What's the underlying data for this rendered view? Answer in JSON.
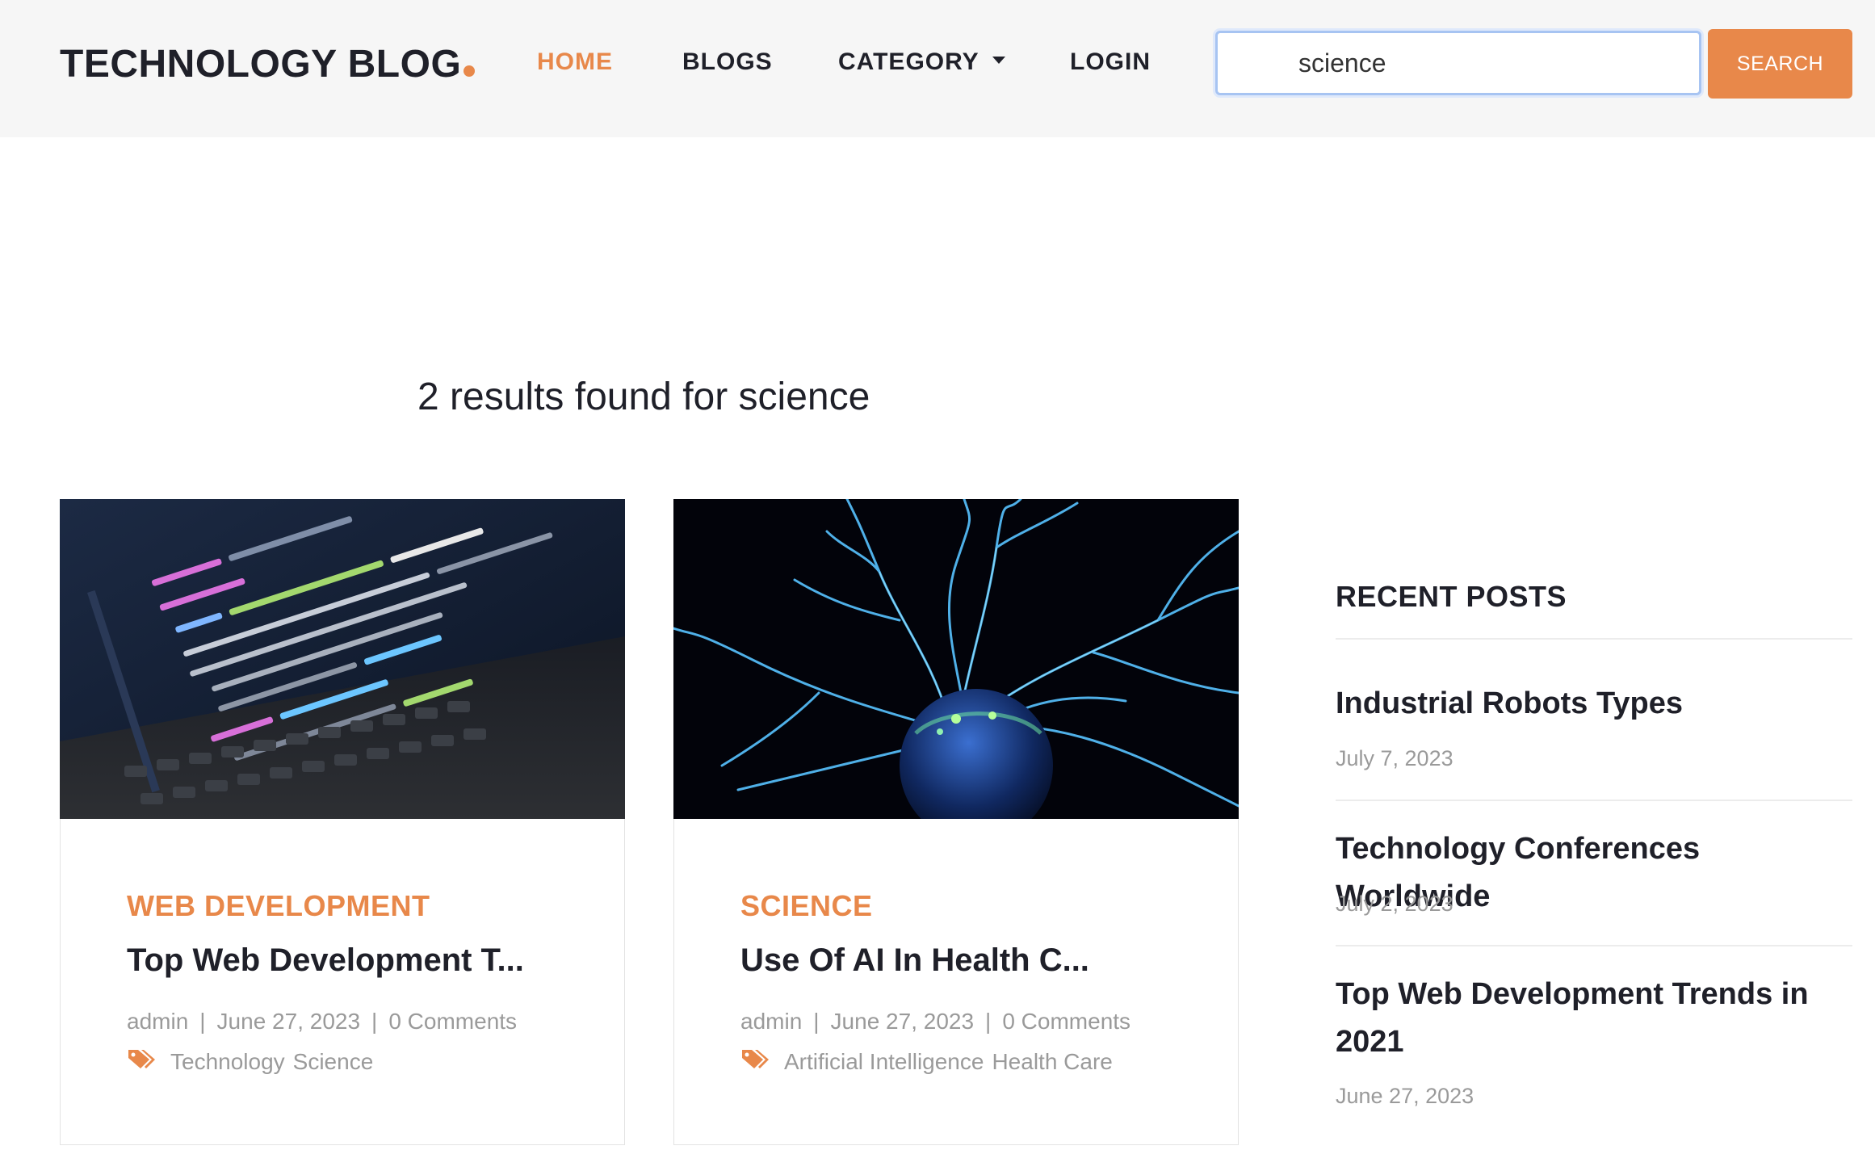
{
  "header": {
    "logo": "TECHNOLOGY BLOG",
    "nav": {
      "home": "HOME",
      "blogs": "BLOGS",
      "category": "CATEGORY",
      "login": "LOGIN"
    },
    "search": {
      "value": "science",
      "button": "SEARCH"
    }
  },
  "results": {
    "heading": "2 results found for science"
  },
  "cards": [
    {
      "category": "WEB DEVELOPMENT",
      "title": "Top Web Development T...",
      "author": "admin",
      "date": "June 27, 2023",
      "comments": "0 Comments",
      "tags": [
        "Technology",
        "Science"
      ],
      "image": "code-on-laptop-screen"
    },
    {
      "category": "SCIENCE",
      "title": "Use Of AI In Health C...",
      "author": "admin",
      "date": "June 27, 2023",
      "comments": "0 Comments",
      "tags": [
        "Artificial Intelligence",
        "Health Care"
      ],
      "image": "plasma-ball"
    }
  ],
  "sidebar": {
    "title": "RECENT POSTS",
    "posts": [
      {
        "title": "Industrial Robots Types",
        "date": "July 7, 2023"
      },
      {
        "title": "Technology Conferences Worldwide",
        "date": "July 2, 2023"
      },
      {
        "title": "Top Web Development Trends in 2021",
        "date": "June 27, 2023"
      }
    ]
  },
  "colors": {
    "accent": "#e8884a",
    "text": "#1f2029",
    "muted": "#9a9a9a",
    "header_bg": "#f6f6f6"
  }
}
